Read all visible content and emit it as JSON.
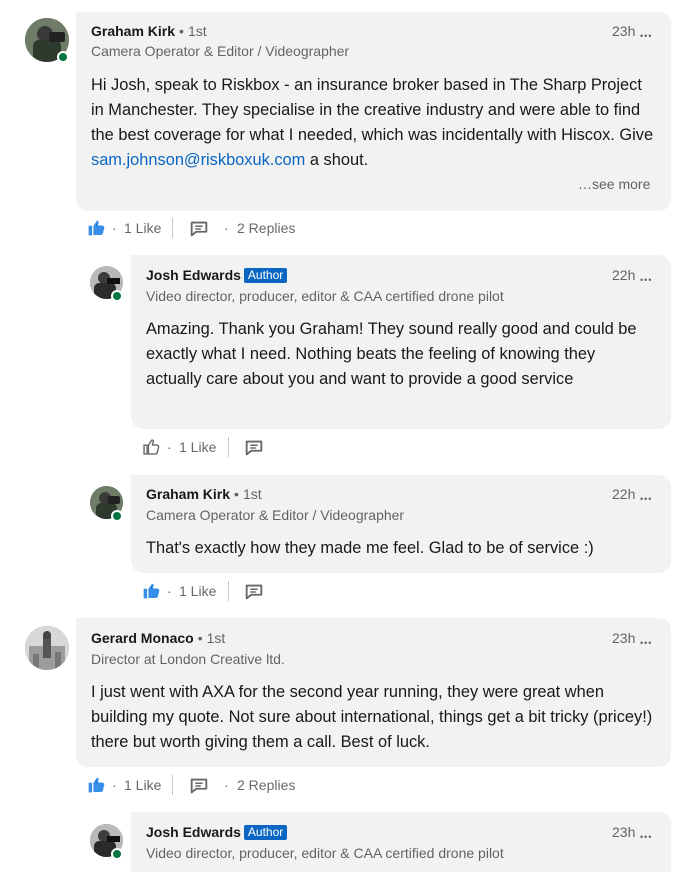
{
  "colors": {
    "brand_blue": "#0a66c2",
    "online_green": "#057642",
    "bubble_bg": "#f2f2f2"
  },
  "icons": {
    "like_filled": "like-icon",
    "like_outline": "like-outline-icon",
    "comment": "comment-icon",
    "menu": "ellipsis-icon"
  },
  "comments": [
    {
      "author": "Graham Kirk",
      "degree": "1st",
      "headline": "Camera Operator & Editor / Videographer",
      "time": "23h",
      "text_before_link": "Hi Josh, speak to Riskbox - an insurance broker based in The Sharp Project in Manchester. They specialise in the creative industry and were able to find the best coverage for what I needed, which was incidentally with Hiscox. Give ",
      "link": "sam.johnson@riskboxuk.com",
      "text_after_link": " a shout.",
      "see_more": "…see more",
      "likes": "1 Like",
      "replies": "2 Replies"
    },
    {
      "author": "Josh Edwards",
      "badge": "Author",
      "headline": "Video director, producer, editor & CAA certified drone pilot",
      "time": "22h",
      "text": "Amazing. Thank you Graham! They sound really good and could be exactly what I need. Nothing beats the feeling of knowing they actually care about you and want to provide a good service",
      "likes": "1 Like"
    },
    {
      "author": "Graham Kirk",
      "degree": "1st",
      "headline": "Camera Operator & Editor / Videographer",
      "time": "22h",
      "text": "That's exactly how they made me feel. Glad to be of service :)",
      "likes": "1 Like"
    },
    {
      "author": "Gerard Monaco",
      "degree": "1st",
      "headline": "Director at London Creative ltd.",
      "time": "23h",
      "text": "I just went with AXA for the second year running, they were great when building my quote. Not sure about international, things get a bit tricky (pricey!) there but worth giving them a call. Best of luck.",
      "likes": "1 Like",
      "replies": "2 Replies"
    },
    {
      "author": "Josh Edwards",
      "badge": "Author",
      "headline": "Video director, producer, editor & CAA certified drone pilot",
      "time": "23h"
    }
  ],
  "separators": {
    "dot": "•",
    "action_dot": "·",
    "menu": "•••"
  }
}
